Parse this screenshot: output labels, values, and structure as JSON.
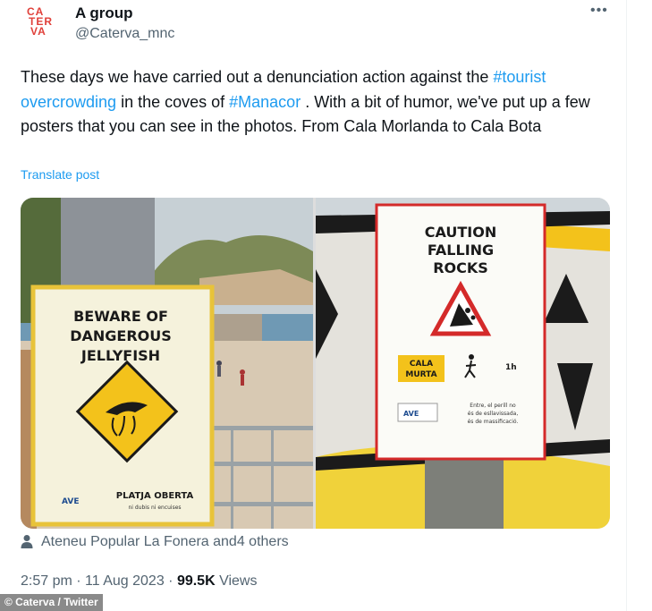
{
  "author": {
    "name": "A group",
    "handle": "@Caterva_mnc",
    "avatar_lines": [
      "CA",
      "TER",
      "VA"
    ]
  },
  "post": {
    "segments": [
      {
        "text": "These days we have carried out a denunciation action against the ",
        "hashtag": false
      },
      {
        "text": "#tourist overcrowding",
        "hashtag": true
      },
      {
        "text": " in the coves of ",
        "hashtag": false
      },
      {
        "text": "#Manacor",
        "hashtag": true
      },
      {
        "text": " . With a bit of humor, we've put up a few posters that you can see in the photos. From Cala Morlanda to Cala Bota",
        "hashtag": false
      }
    ],
    "translate_label": "Translate post"
  },
  "photos": {
    "left_poster": {
      "lines": [
        "BEWARE OF",
        "DANGEROUS",
        "JELLYFISH"
      ],
      "footer_main": "PLATJA OBERTA",
      "footer_sub": "ni dubis ni encuises",
      "logo": "AVE"
    },
    "right_poster": {
      "lines": [
        "CAUTION",
        "FALLING",
        "ROCKS"
      ],
      "place_line1": "CALA",
      "place_line2": "MURTA",
      "time": "1h",
      "note_lines": [
        "Entre, el perill no",
        "és de esllavissada,",
        "és de massificació."
      ],
      "logo": "AVE"
    }
  },
  "tagged": "Ateneu Popular La Fonera and4 others",
  "meta": {
    "time": "2:57 pm",
    "separator": " · ",
    "date": "11 Aug 2023",
    "views_count": "99.5K",
    "views_label": " Views"
  },
  "credit": "© Caterva / Twitter",
  "colors": {
    "link": "#1d9bf0",
    "secondary_text": "#536471",
    "poster_red": "#d42a2a",
    "poster_yellow": "#f3c21b"
  }
}
